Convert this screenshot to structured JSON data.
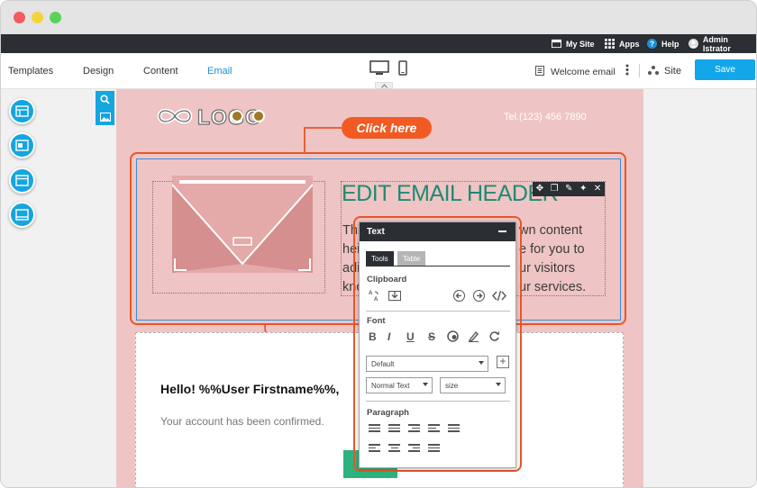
{
  "topbar": {
    "my_site": "My Site",
    "apps": "Apps",
    "help": "Help",
    "user": "Admin Istrator"
  },
  "menu": {
    "templates": "Templates",
    "design": "Design",
    "content": "Content",
    "email": "Email",
    "welcome_email": "Welcome email",
    "site": "Site",
    "save": "Save"
  },
  "email": {
    "logo": "LOGO",
    "tel": "Tel.(123) 456 7890",
    "click_here": "Click here",
    "header": "EDIT EMAIL HEADER",
    "body_lines": [
      "Thi",
      "hei",
      "adi",
      "kno"
    ],
    "body_right": [
      "wn content",
      "e for you to",
      "ur visitors",
      "ur services."
    ],
    "hello": "Hello! %%User Firstname%%,",
    "confirmed": "Your account has been confirmed."
  },
  "text_panel": {
    "title": "Text",
    "tab_tools": "Tools",
    "tab_table": "Table",
    "clipboard": "Clipboard",
    "font": "Font",
    "font_bold": "B",
    "font_italic": "I",
    "font_underline": "U",
    "font_strike": "S",
    "font_family": "Default",
    "font_style": "Normal Text",
    "font_size": "size",
    "paragraph": "Paragraph",
    "plus": "+"
  },
  "colors": {
    "accent": "#13a6e8",
    "orange": "#f15a22",
    "canvas": "#eec5c4",
    "header_green": "#1e8a73",
    "dark_bar": "#2b2e33"
  }
}
